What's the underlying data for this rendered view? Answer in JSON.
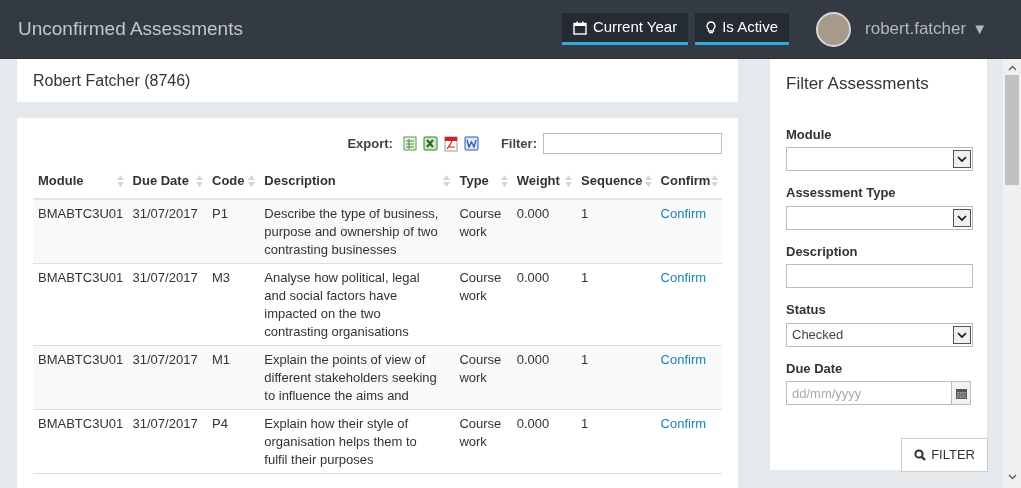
{
  "header": {
    "title": "Unconfirmed Assessments",
    "toggles": [
      {
        "kind": "calendar",
        "label": "Current Year",
        "on": true
      },
      {
        "kind": "bulb",
        "label": "Is Active",
        "on": true
      }
    ],
    "user": "robert.fatcher",
    "menu_caret": "▼"
  },
  "student": {
    "name": "Robert Fatcher (8746)"
  },
  "toolbar": {
    "export_label": "Export:",
    "filter_label": "Filter:"
  },
  "table": {
    "columns": [
      "Module",
      "Due Date",
      "Code",
      "Description",
      "Type",
      "Weight",
      "Sequence",
      "Confirm"
    ],
    "rows": [
      {
        "module": "BMABTC3U01",
        "due_date": "31/07/2017",
        "code": "P1",
        "description": "Describe the type of business, purpose and ownership of two contrasting businesses",
        "type": "Course work",
        "weight": "0.000",
        "sequence": "1",
        "confirm": "Confirm"
      },
      {
        "module": "BMABTC3U01",
        "due_date": "31/07/2017",
        "code": "M3",
        "description": "Analyse how political, legal and social factors have impacted on the two contrasting organisations",
        "type": "Course work",
        "weight": "0.000",
        "sequence": "1",
        "confirm": "Confirm"
      },
      {
        "module": "BMABTC3U01",
        "due_date": "31/07/2017",
        "code": "M1",
        "description": "Explain the points of view of different stakeholders seeking to influence the aims and",
        "type": "Course work",
        "weight": "0.000",
        "sequence": "1",
        "confirm": "Confirm"
      },
      {
        "module": "BMABTC3U01",
        "due_date": "31/07/2017",
        "code": "P4",
        "description": "Explain how their style of organisation helps them to fulfil their purposes",
        "type": "Course work",
        "weight": "0.000",
        "sequence": "1",
        "confirm": "Confirm"
      }
    ]
  },
  "filter_panel": {
    "title": "Filter Assessments",
    "fields": [
      {
        "kind": "select",
        "label": "Module"
      },
      {
        "kind": "select",
        "label": "Assessment Type"
      },
      {
        "kind": "text",
        "label": "Description"
      },
      {
        "kind": "select",
        "label": "Status",
        "value": "Checked"
      },
      {
        "kind": "date",
        "label": "Due Date",
        "placeholder": "dd/mm/yyyy"
      }
    ],
    "button": "FILTER"
  }
}
